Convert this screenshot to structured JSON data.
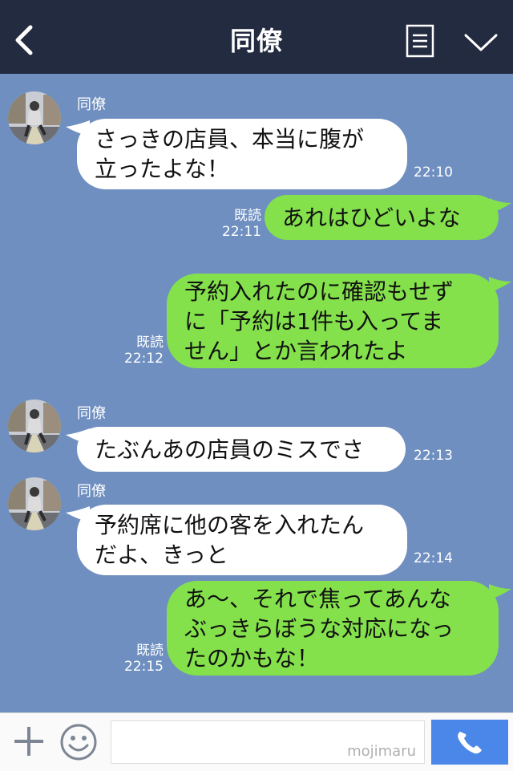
{
  "header": {
    "title": "同僚"
  },
  "messages": [
    {
      "side": "in",
      "sender": "同僚",
      "lines": [
        "さっきの店員、本当に腹が",
        "立ったよな！"
      ],
      "time": "22:10"
    },
    {
      "side": "out",
      "read": "既読",
      "lines": [
        "あれはひどいよな"
      ],
      "time": "22:11"
    },
    {
      "side": "out",
      "read": "既読",
      "lines": [
        "予約入れたのに確認もせず",
        "に「予約は1件も入ってま",
        "せん」とか言われたよ"
      ],
      "time": "22:12"
    },
    {
      "side": "in",
      "sender": "同僚",
      "lines": [
        "たぶんあの店員のミスでさ"
      ],
      "time": "22:13"
    },
    {
      "side": "in",
      "sender": "同僚",
      "lines": [
        "予約席に他の客を入れたん",
        "だよ、きっと"
      ],
      "time": "22:14"
    },
    {
      "side": "out",
      "read": "既読",
      "lines": [
        "あ～、それで焦ってあんな",
        "ぶっきらぼうな対応になっ",
        "たのかもな！"
      ],
      "time": "22:15"
    }
  ],
  "footer": {
    "watermark": "mojimaru"
  },
  "colors": {
    "header": "#232b40",
    "chat_bg": "#6f8fc0",
    "outgoing": "#84e14c",
    "incoming": "#ffffff",
    "send": "#4a87e8"
  }
}
